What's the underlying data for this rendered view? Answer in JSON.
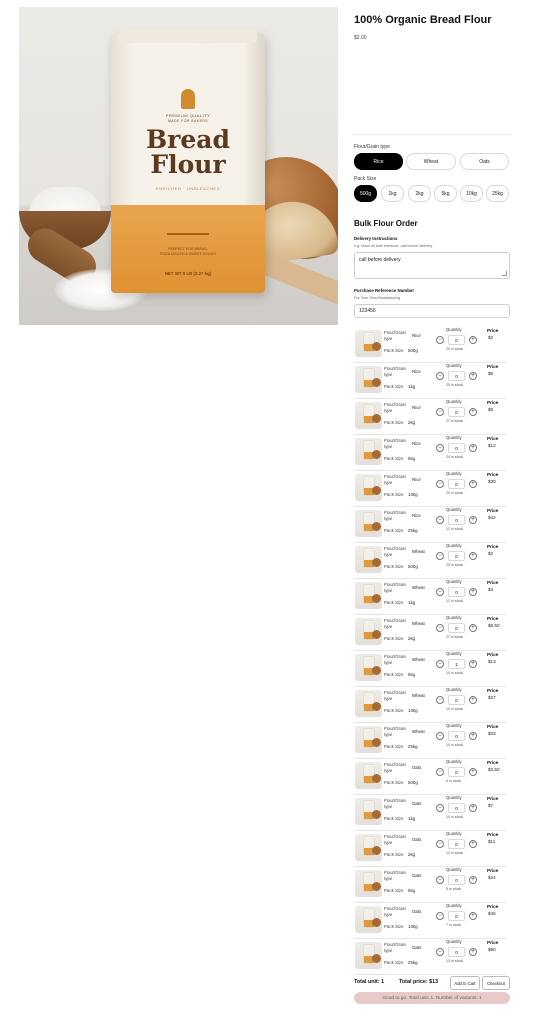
{
  "product": {
    "title": "100% Organic Bread Flour",
    "price": "$2.00",
    "image": {
      "bag_top_line": "PREMIUM QUALITY",
      "bag_top_subline": "MADE FOR BAKERS",
      "brand_line1": "Bread",
      "brand_line2": "Flour",
      "bag_subtitle": "ENRICHED · UNBLEACHED",
      "bag_note_1": "PERFECT FOR BREAD,",
      "bag_note_2": "PIZZA DOUGH & SWEET DOUGH",
      "bag_weight": "NET WT 5 LB (2.27 kg)"
    }
  },
  "options": {
    "grain_label": "Flour/Grain type",
    "grain": [
      {
        "label": "Rice",
        "selected": true
      },
      {
        "label": "Wheat",
        "selected": false
      },
      {
        "label": "Oats",
        "selected": false
      }
    ],
    "pack_label": "Pack Size",
    "pack": [
      {
        "label": "500g",
        "selected": true
      },
      {
        "label": "1kg",
        "selected": false
      },
      {
        "label": "2kg",
        "selected": false
      },
      {
        "label": "5kg",
        "selected": false
      },
      {
        "label": "10kg",
        "selected": false
      },
      {
        "label": "25kg",
        "selected": false
      }
    ]
  },
  "bulk": {
    "title": "Bulk Flour Order",
    "delivery_label": "Delivery Instructions",
    "delivery_hint": "e.g. leave at side entrance, call before delivery",
    "delivery_value": "call before delivery",
    "po_label": "Purchase Reference Number",
    "po_hint": "For Your Own Bookkeeping",
    "po_value": "123456"
  },
  "row_labels": {
    "attr1": "Flour/Grain",
    "attr1b": "type",
    "attr2": "Pack Size",
    "quantity": "Quantity",
    "price": "Price",
    "minus": "−",
    "plus": "+"
  },
  "variants": [
    {
      "grain": "Rice",
      "size": "500g",
      "qty": "0",
      "stock": "20 in stock",
      "price": "$2"
    },
    {
      "grain": "Rice",
      "size": "1kg",
      "qty": "0",
      "stock": "25 in stock",
      "price": "$5"
    },
    {
      "grain": "Rice",
      "size": "2kg",
      "qty": "0",
      "stock": "27 in stock",
      "price": "$6"
    },
    {
      "grain": "Rice",
      "size": "5kg",
      "qty": "0",
      "stock": "24 in stock",
      "price": "$12"
    },
    {
      "grain": "Rice",
      "size": "10kg",
      "qty": "0",
      "stock": "20 in stock",
      "price": "$30"
    },
    {
      "grain": "Rice",
      "size": "25kg",
      "qty": "0",
      "stock": "12 in stock",
      "price": "$42"
    },
    {
      "grain": "Wheat",
      "size": "500g",
      "qty": "0",
      "stock": "25 in stock",
      "price": "$2"
    },
    {
      "grain": "Wheat",
      "size": "1kg",
      "qty": "0",
      "stock": "12 in stock",
      "price": "$4"
    },
    {
      "grain": "Wheat",
      "size": "2kg",
      "qty": "0",
      "stock": "27 in stock",
      "price": "$8.50"
    },
    {
      "grain": "Wheat",
      "size": "5kg",
      "qty": "1",
      "stock": "10 in stock",
      "price": "$13"
    },
    {
      "grain": "Wheat",
      "size": "10kg",
      "qty": "0",
      "stock": "10 in stock",
      "price": "$27"
    },
    {
      "grain": "Wheat",
      "size": "25kg",
      "qty": "0",
      "stock": "10 in stock",
      "price": "$33"
    },
    {
      "grain": "Oats",
      "size": "500g",
      "qty": "0",
      "stock": "6 in stock",
      "price": "$3.50"
    },
    {
      "grain": "Oats",
      "size": "1kg",
      "qty": "0",
      "stock": "10 in stock",
      "price": "$7"
    },
    {
      "grain": "Oats",
      "size": "2kg",
      "qty": "0",
      "stock": "12 in stock",
      "price": "$11"
    },
    {
      "grain": "Oats",
      "size": "5kg",
      "qty": "0",
      "stock": "5 in stock",
      "price": "$24"
    },
    {
      "grain": "Oats",
      "size": "10kg",
      "qty": "0",
      "stock": "7 in stock",
      "price": "$45"
    },
    {
      "grain": "Oats",
      "size": "25kg",
      "qty": "0",
      "stock": "13 in stock",
      "price": "$90"
    }
  ],
  "footer": {
    "total_unit_label": "Total unit:",
    "total_unit": "1",
    "total_price_label": "Total price:",
    "total_price": "$13",
    "add_to_cart": "Add to Cart",
    "checkout": "Checkout",
    "status": "Good to go. Total unit: 1. Number of variants: 1"
  },
  "colors": {
    "accent": "#000000",
    "status_bg": "#e9c9c9",
    "status_text": "#3d7c3d"
  }
}
